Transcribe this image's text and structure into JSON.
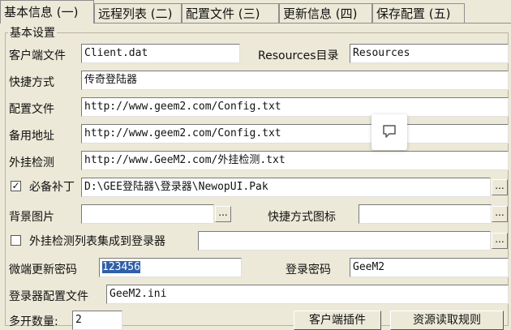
{
  "tabs": [
    "基本信息 (一)",
    "远程列表 (二)",
    "配置文件 (三)",
    "更新信息 (四)",
    "保存配置 (五)"
  ],
  "group_title": "基本设置",
  "fields": {
    "client_file_label": "客户端文件",
    "client_file_value": "Client.dat",
    "resources_label": "Resources目录",
    "resources_value": "Resources",
    "shortcut_label": "快捷方式",
    "shortcut_value": "传奇登陆器",
    "config_label": "配置文件",
    "config_value": "http://www.geem2.com/Config.txt",
    "backup_label": "备用地址",
    "backup_value": "http://www.geem2.com/Config.txt",
    "plugin_label": "外挂检测",
    "plugin_value": "http://www.GeeM2.com/外挂检测.txt",
    "patch_label": "必备补丁",
    "patch_value": "D:\\GEE登陆器\\登录器\\NewopUI.Pak",
    "bg_label": "背景图片",
    "bg_value": "",
    "shortcut_icon_label": "快捷方式图标",
    "shortcut_icon_value": "",
    "integrate_label": "外挂检测列表集成到登录器",
    "integrate_value": "",
    "micro_pwd_label": "微端更新密码",
    "micro_pwd_value": "123456",
    "login_pwd_label": "登录密码",
    "login_pwd_value": "GeeM2",
    "launcher_cfg_label": "登录器配置文件",
    "launcher_cfg_value": "GeeM2.ini",
    "multi_open_label": "多开数量:",
    "multi_open_value": "2"
  },
  "buttons": {
    "client_plugin": "客户端插件",
    "resource_extract": "资源读取规则"
  },
  "browse_glyph": "...",
  "check_mark": "✓"
}
